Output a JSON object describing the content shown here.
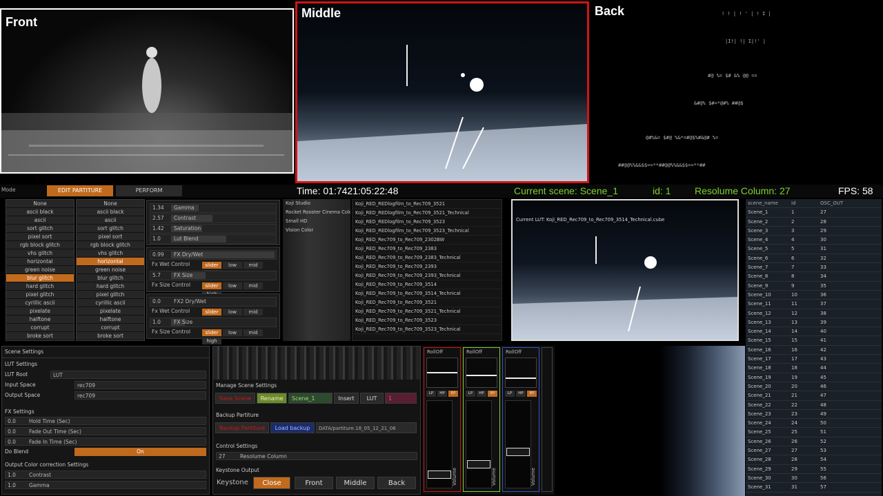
{
  "videos": {
    "front": "Front",
    "middle": "Middle",
    "back": "Back"
  },
  "topbar": {
    "mode_label": "Mode",
    "edit_tab": "EDIT PARTITURE",
    "perform_tab": "PERFORM",
    "time": "Time: 01:7421:05:22:48",
    "current_scene": "Current scene: Scene_1",
    "id": "id: 1",
    "resolume_column": "Resolume Column: 27",
    "fps": "FPS: 58"
  },
  "fx_lists": {
    "left": [
      "None",
      "ascii black",
      "ascii",
      "sort glitch",
      "pixel sort",
      "rgb block glitch",
      "vhs glitch",
      "horizontal",
      "green noise",
      "blur glitch",
      "hard glitch",
      "pixel glitch",
      "cyrillic ascii",
      "pixelate",
      "halftone",
      "corrupt",
      "broke sort"
    ],
    "left_selected": 9,
    "right": [
      "None",
      "ascii black",
      "ascii",
      "sort glitch",
      "pixel sort",
      "rgb block glitch",
      "vhs glitch",
      "horizontal",
      "green noise",
      "blur glitch",
      "hard glitch",
      "pixel glitch",
      "cyrillic ascii",
      "pixelate",
      "halftone",
      "corrupt",
      "broke sort"
    ],
    "right_selected": 7
  },
  "color": {
    "gamma_v": "1.34",
    "gamma": "Gamma",
    "contrast_v": "2.57",
    "contrast": "Contrast",
    "saturation_v": "1.42",
    "saturation": "Saturation",
    "lutblend_v": "1.0",
    "lutblend": "Lut Blend"
  },
  "fx1": {
    "drywet_v": "0.99",
    "drywet": "FX Dry/Wet",
    "wet_ctrl": "Fx Wet Control",
    "size_v": "5.7",
    "size": "FX Size",
    "size_ctrl": "Fx Size Control"
  },
  "fx2": {
    "drywet_v": "0.0",
    "drywet": "FX2 Dry/Wet",
    "wet_ctrl": "Fx Wet Control",
    "size_v": "1.0",
    "size": "FX Size",
    "size_ctrl": "Fx Size Control"
  },
  "mini_labels": {
    "slider": "slider",
    "low": "low",
    "mid": "mid",
    "high": "high"
  },
  "lut_categories": [
    "Koji Studio",
    "Rocket Rooster Cinema Color",
    "Small HD",
    "Vision Color"
  ],
  "lut_files": [
    "Koji_RED_REDlogfilm_to_Rec709_3521",
    "Koji_RED_REDlogfilm_to_Rec709_3521_Technical",
    "Koji_RED_REDlogfilm_to_Rec709_3523",
    "Koji_RED_REDlogfilm_to_Rec709_3523_Technical",
    "Koji_RED_Rec709_to_Rec709_2302BW",
    "Koji_RED_Rec709_to_Rec709_2383",
    "Koji_RED_Rec709_to_Rec709_2383_Technical",
    "Koji_RED_Rec709_to_Rec709_2393",
    "Koji_RED_Rec709_to_Rec709_2393_Technical",
    "Koji_RED_Rec709_to_Rec709_3514",
    "Koji_RED_Rec709_to_Rec709_3514_Technical",
    "Koji_RED_Rec709_to_Rec709_3521",
    "Koji_RED_Rec709_to_Rec709_3521_Technical",
    "Koji_RED_Rec709_to_Rec709_3523",
    "Koji_RED_Rec709_to_Rec709_3523_Technical"
  ],
  "preview": {
    "current_lut": "Current LUT:   Koji_RED_Rec709_to_Rec709_3514_Technical.cube"
  },
  "scene_table": {
    "headers": [
      "scene_name",
      "id",
      "OSC_OUT"
    ],
    "rows": [
      [
        "Scene_1",
        "1",
        "27"
      ],
      [
        "Scene_2",
        "2",
        "28"
      ],
      [
        "Scene_3",
        "3",
        "29"
      ],
      [
        "Scene_4",
        "4",
        "30"
      ],
      [
        "Scene_5",
        "5",
        "31"
      ],
      [
        "Scene_6",
        "6",
        "32"
      ],
      [
        "Scene_7",
        "7",
        "33"
      ],
      [
        "Scene_8",
        "8",
        "34"
      ],
      [
        "Scene_9",
        "9",
        "35"
      ],
      [
        "Scene_10",
        "10",
        "36"
      ],
      [
        "Scene_11",
        "11",
        "37"
      ],
      [
        "Scene_12",
        "12",
        "38"
      ],
      [
        "Scene_13",
        "13",
        "39"
      ],
      [
        "Scene_14",
        "14",
        "40"
      ],
      [
        "Scene_15",
        "15",
        "41"
      ],
      [
        "Scene_16",
        "16",
        "42"
      ],
      [
        "Scene_17",
        "17",
        "43"
      ],
      [
        "Scene_18",
        "18",
        "44"
      ],
      [
        "Scene_19",
        "19",
        "45"
      ],
      [
        "Scene_20",
        "20",
        "46"
      ],
      [
        "Scene_21",
        "21",
        "47"
      ],
      [
        "Scene_22",
        "22",
        "48"
      ],
      [
        "Scene_23",
        "23",
        "49"
      ],
      [
        "Scene_24",
        "24",
        "50"
      ],
      [
        "Scene_25",
        "25",
        "51"
      ],
      [
        "Scene_26",
        "26",
        "52"
      ],
      [
        "Scene_27",
        "27",
        "53"
      ],
      [
        "Scene_28",
        "28",
        "54"
      ],
      [
        "Scene_29",
        "29",
        "55"
      ],
      [
        "Scene_30",
        "30",
        "56"
      ],
      [
        "Scene_31",
        "31",
        "57"
      ]
    ]
  },
  "scene_settings": {
    "title": "Scene Settings",
    "lut_settings": "LUT Settings",
    "lut_root": "LUT Root",
    "lut_root_v": "LUT",
    "input_space": "Input Space",
    "input_space_v": "rec709",
    "output_space": "Output Space",
    "output_space_v": "rec709",
    "fx_settings": "FX Settings",
    "hold_v": "0.0",
    "hold": "Hold Time (Sec)",
    "fadeout_v": "0.0",
    "fadeout": "Fade Out Time (Sec)",
    "fadein_v": "0.0",
    "fadein": "Fade In Time (Sec)",
    "do_blend": "Do Blend",
    "do_blend_v": "On",
    "occ": "Output Color correction  Settings",
    "contrast_v": "1.0",
    "contrast": "Contrast",
    "gamma_v": "1.0",
    "gamma": "Gamma"
  },
  "manage": {
    "title": "Manage Scene Settings",
    "save": "Save Scene",
    "rename": "Rename",
    "scene": "Scene_1",
    "insert": "Insert",
    "lut": "LUT",
    "num": "1",
    "backup_title": "Backup Partiture",
    "backup": "Backup Partiture",
    "load": "Load backup",
    "path": "DATA/partiture.18_05_12_21_06",
    "control_title": "Control Settings",
    "res_v": "27",
    "res": "Resolume Column",
    "keystone_title": "Keystone Output",
    "keystone": "Keystone",
    "close": "Close",
    "front": "Front",
    "middle": "Middle",
    "back": "Back"
  },
  "mixer": {
    "rolloff": "RollOff",
    "lp": "LP",
    "hp": "HP",
    "bp": "BP",
    "volume": "Volume",
    "levels": [
      0.1,
      0.22,
      0.36
    ]
  },
  "colors": {
    "accent": "#c06a1e",
    "green": "#7fd12f",
    "red": "#d01515"
  }
}
